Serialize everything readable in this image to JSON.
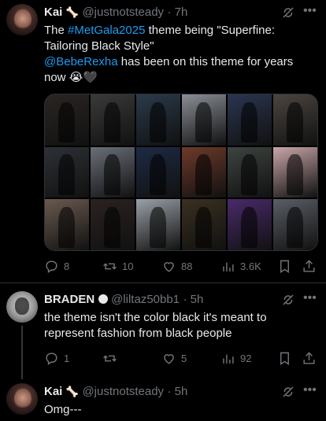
{
  "tweets": [
    {
      "display_name": "Kai",
      "name_emoji": "🦴",
      "handle": "@justnotsteady",
      "time": "· 7h",
      "text_part1": "The ",
      "hashtag": "#MetGala2025",
      "text_part2": " theme being \"Superfine: Tailoring Black Style\"",
      "mention": "@BebeRexha",
      "text_part3": " has been on this theme for years now ",
      "emojis": "😭🖤",
      "stats": {
        "replies": "8",
        "retweets": "10",
        "likes": "88",
        "views": "3.6K"
      }
    },
    {
      "display_name": "BRADEN",
      "handle": "@liltaz50bb1",
      "time": "· 5h",
      "text": "the theme isn't the color black it's meant to represent fashion from black people",
      "stats": {
        "replies": "1",
        "retweets": "",
        "likes": "5",
        "views": "92"
      }
    },
    {
      "display_name": "Kai",
      "name_emoji": "🦴",
      "handle": "@justnotsteady",
      "time": "· 5h",
      "text": "Omg---"
    }
  ],
  "colors": {
    "link": "#1d9bf0",
    "muted": "#71767b",
    "text": "#e7e9ea",
    "background": "#000000"
  },
  "icons": [
    "grok-icon",
    "more-icon",
    "reply-icon",
    "retweet-icon",
    "like-icon",
    "views-icon",
    "bookmark-icon",
    "share-icon"
  ],
  "media_tiles": [
    {
      "bg": "#2a2523"
    },
    {
      "bg": "#3a3a3a"
    },
    {
      "bg": "#2b3a4a"
    },
    {
      "bg": "#8a8e96"
    },
    {
      "bg": "#2a3550"
    },
    {
      "bg": "#4b4540"
    },
    {
      "bg": "#2d3136"
    },
    {
      "bg": "#6a6f78"
    },
    {
      "bg": "#1e2a44"
    },
    {
      "bg": "#6e3a2a"
    },
    {
      "bg": "#3e4440"
    },
    {
      "bg": "#c9a6a8"
    },
    {
      "bg": "#6a5a50"
    },
    {
      "bg": "#2b2220"
    },
    {
      "bg": "#9aa0a8"
    },
    {
      "bg": "#3a3020"
    },
    {
      "bg": "#4a2a6a"
    },
    {
      "bg": "#5a5e66"
    }
  ]
}
